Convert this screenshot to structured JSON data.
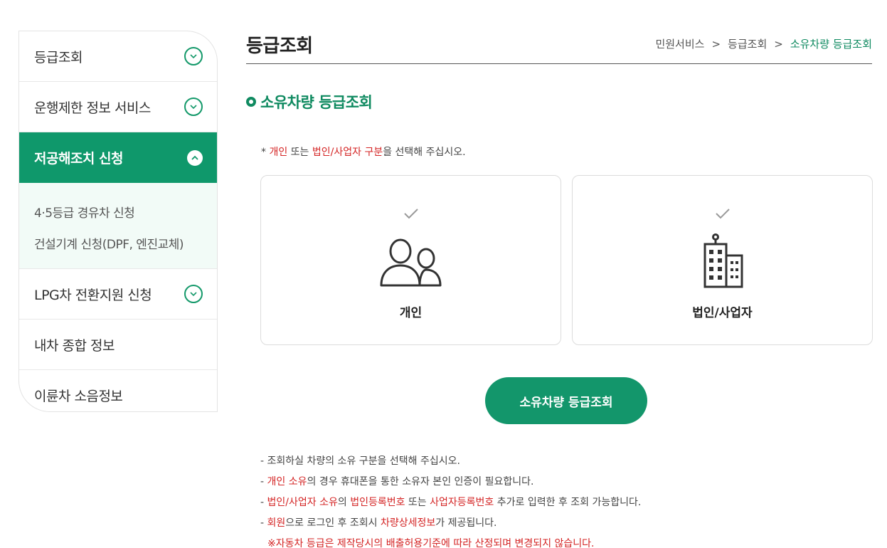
{
  "sidebar": {
    "items": [
      {
        "label": "등급조회"
      },
      {
        "label": "운행제한 정보 서비스"
      },
      {
        "label": "저공해조치 신청"
      },
      {
        "label": "LPG차 전환지원 신청"
      },
      {
        "label": "내차 종합 정보"
      },
      {
        "label": "이륜차 소음정보"
      }
    ],
    "submenu": [
      "4·5등급 경유차 신청",
      "건설기계 신청(DPF, 엔진교체)"
    ]
  },
  "header": {
    "title": "등급조회",
    "breadcrumb": [
      "민원서비스",
      "등급조회",
      "소유차량 등급조회"
    ],
    "separator": ">"
  },
  "section": {
    "title": "소유차량 등급조회"
  },
  "notice": {
    "prefix": "* ",
    "red1": "개인",
    "mid": " 또는 ",
    "red2": "법인/사업자 구분",
    "suffix": "을 선택해 주십시오."
  },
  "cards": {
    "personal": "개인",
    "business": "법인/사업자"
  },
  "button": {
    "label": "소유차량 등급조회"
  },
  "info": {
    "line1": "- 조회하실 차량의 소유 구분을 선택해 주십시오.",
    "line2": {
      "dash": "- ",
      "red": "개인 소유",
      "rest": "의 경우 휴대폰을 통한 소유자 본인 인증이 필요합니다."
    },
    "line3": {
      "dash": "- ",
      "red1": "법인/사업자 소유",
      "t1": "의 ",
      "red2": "법인등록번호",
      "t2": " 또는 ",
      "red3": "사업자등록번호",
      "t3": " 추가로 입력한 후 조회 가능합니다."
    },
    "line4": {
      "dash": "- ",
      "red1": "회원",
      "t1": "으로 로그인 후 조회시 ",
      "red2": "차량상세정보",
      "t2": "가 제공됩니다."
    },
    "note": "※자동차 등급은 제작당시의 배출허용기준에 따라 산정되며 변경되지 않습니다."
  },
  "colors": {
    "accent": "#0f986b",
    "red": "#d42424"
  }
}
